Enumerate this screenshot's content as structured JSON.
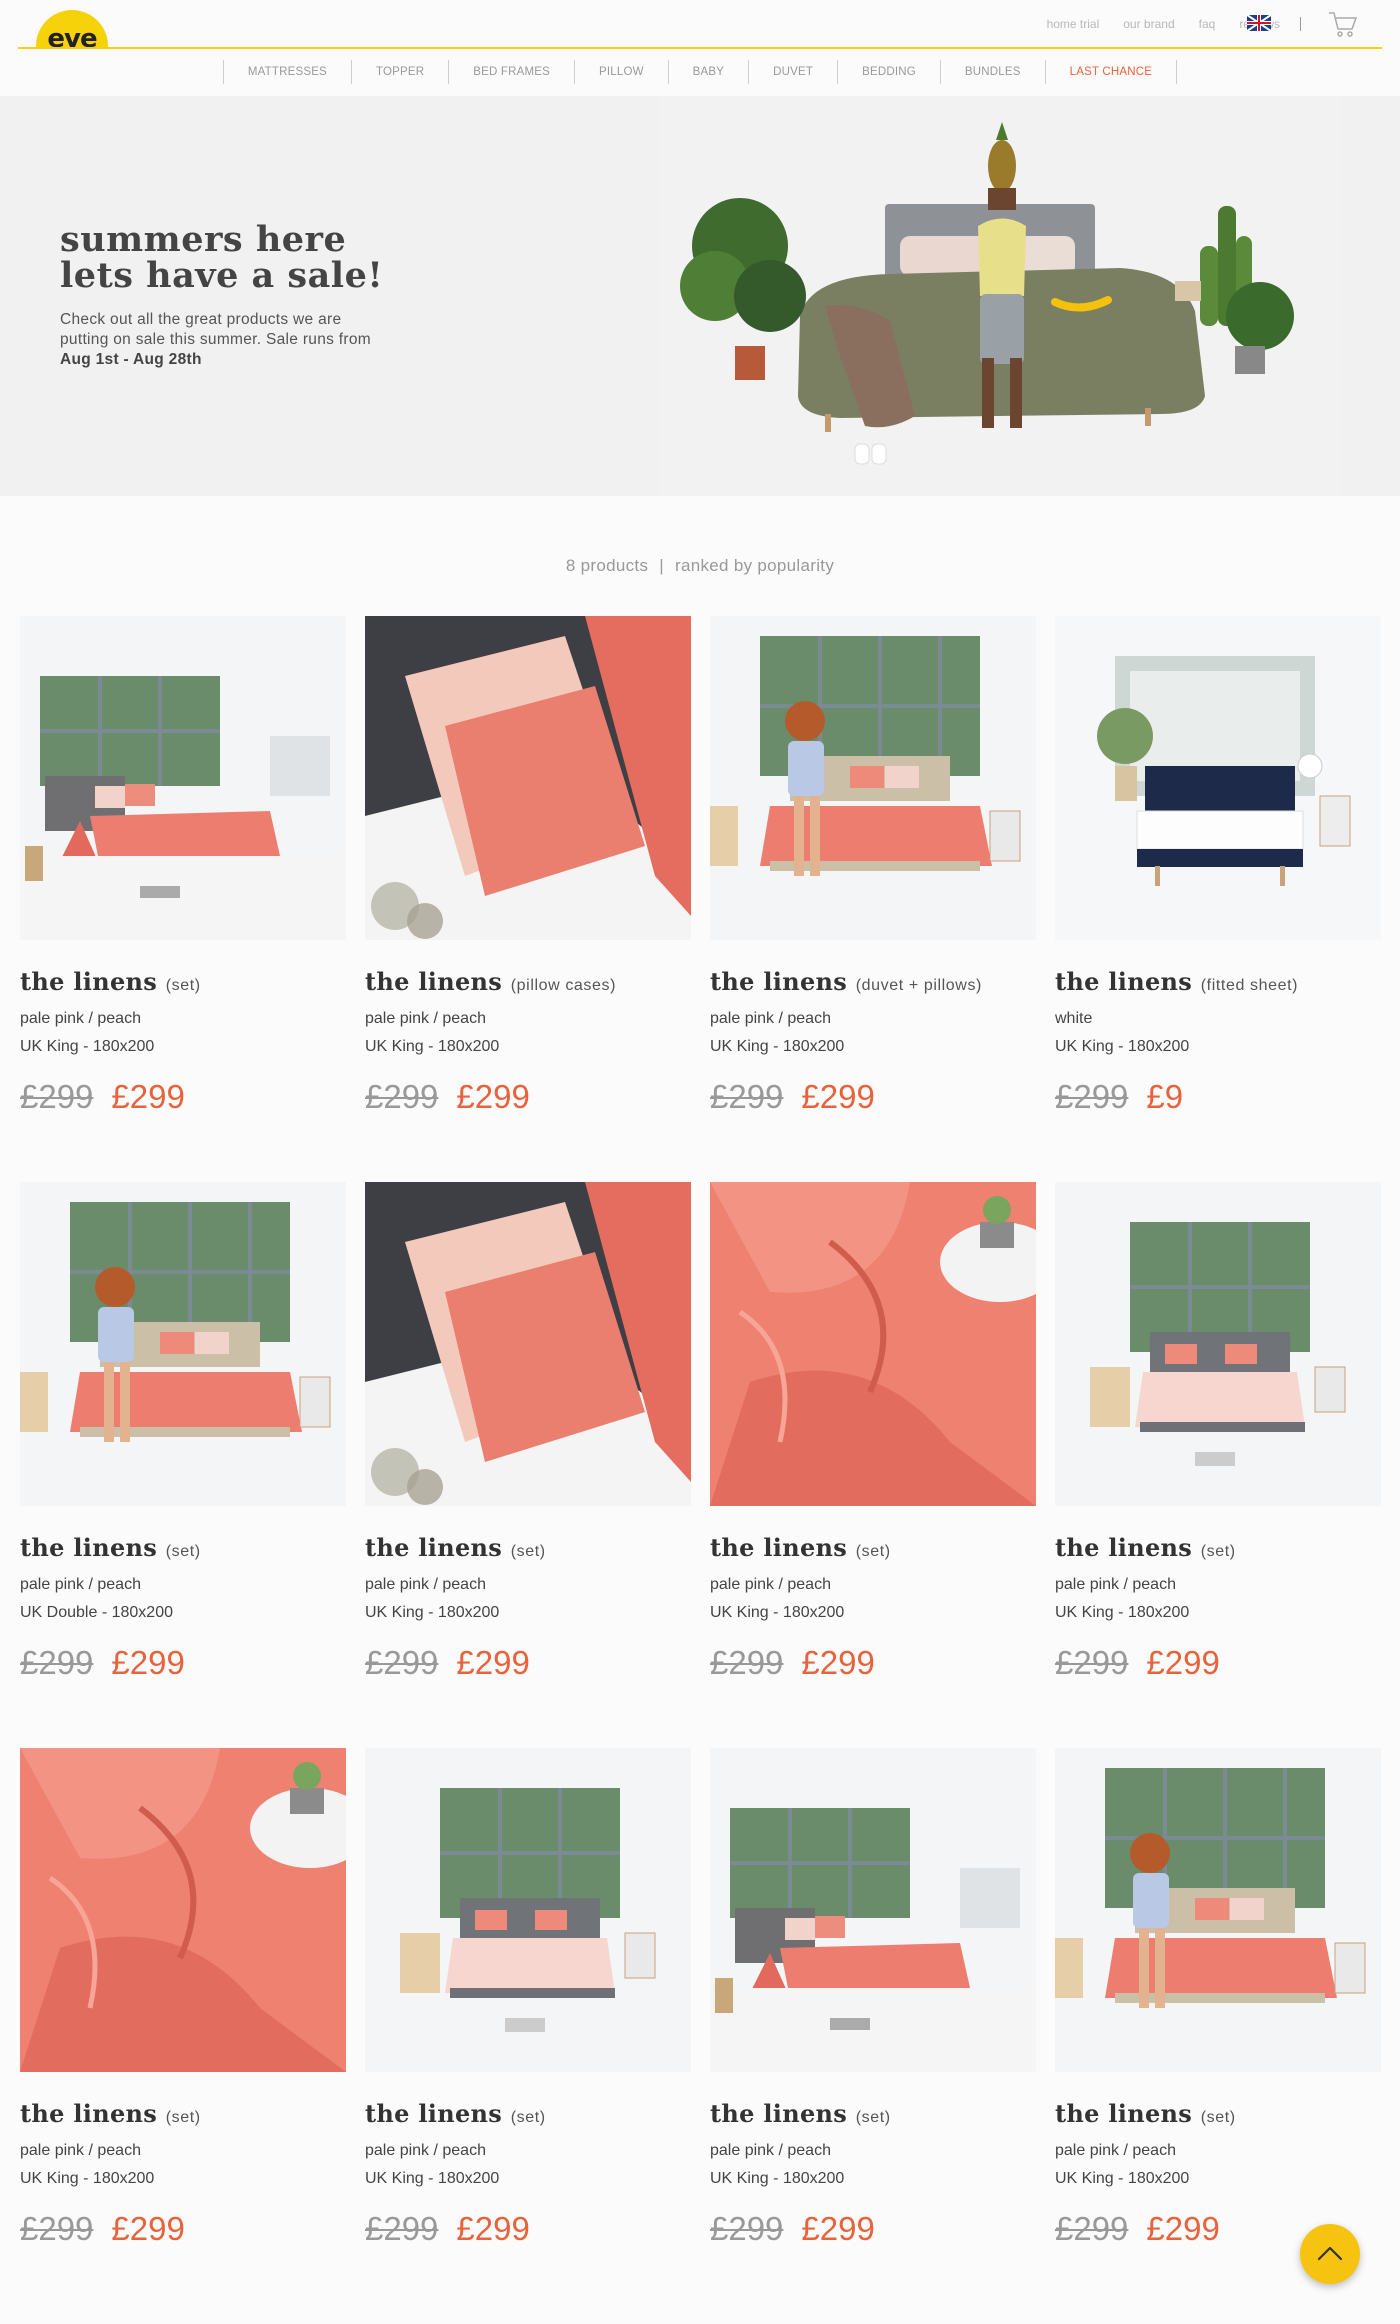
{
  "brand": {
    "logo_text": "eve"
  },
  "top_links": [
    "home trial",
    "our brand",
    "faq",
    "reviews"
  ],
  "nav": [
    "MATTRESSES",
    "TOPPER",
    "BED FRAMES",
    "PILLOW",
    "BABY",
    "DUVET",
    "BEDDING",
    "BUNDLES",
    "LAST CHANCE"
  ],
  "hero": {
    "title_line1": "summers here",
    "title_line2": "lets have a sale!",
    "desc_prefix": "Check out all the great products we are putting on sale this summer. Sale runs from ",
    "desc_dates": "Aug 1st - Aug 28th"
  },
  "listing": {
    "count_text": "8 products",
    "divider": "|",
    "sort_text": "ranked by popularity"
  },
  "colors": {
    "accent": "#e8623c",
    "brand_yellow": "#f6d20a",
    "muted": "#999999"
  },
  "products": [
    {
      "title": "the linens",
      "variant": "(set)",
      "color": "pale pink / peach",
      "size": "UK King - 180x200",
      "old_price": "£299",
      "price": "£299",
      "image": "bedroom-bed-angle"
    },
    {
      "title": "the linens",
      "variant": "(pillow cases)",
      "color": "pale pink / peach",
      "size": "UK King - 180x200",
      "old_price": "£299",
      "price": "£299",
      "image": "pillow-closeup"
    },
    {
      "title": "the linens",
      "variant": "(duvet + pillows)",
      "color": "pale pink / peach",
      "size": "UK King - 180x200",
      "old_price": "£299",
      "price": "£299",
      "image": "woman-on-bed"
    },
    {
      "title": "the linens",
      "variant": "(fitted sheet)",
      "color": "white",
      "size": "UK King - 180x200",
      "old_price": "£299",
      "price": "£9",
      "image": "navy-bed-white-room"
    },
    {
      "title": "the linens",
      "variant": "(set)",
      "color": "pale pink / peach",
      "size": "UK Double - 180x200",
      "old_price": "£299",
      "price": "£299",
      "image": "woman-on-bed"
    },
    {
      "title": "the linens",
      "variant": "(set)",
      "color": "pale pink / peach",
      "size": "UK King - 180x200",
      "old_price": "£299",
      "price": "£299",
      "image": "pillow-closeup"
    },
    {
      "title": "the linens",
      "variant": "(set)",
      "color": "pale pink / peach",
      "size": "UK King - 180x200",
      "old_price": "£299",
      "price": "£299",
      "image": "duvet-closeup"
    },
    {
      "title": "the linens",
      "variant": "(set)",
      "color": "pale pink / peach",
      "size": "UK King - 180x200",
      "old_price": "£299",
      "price": "£299",
      "image": "bedroom-bed-front"
    },
    {
      "title": "the linens",
      "variant": "(set)",
      "color": "pale pink / peach",
      "size": "UK King - 180x200",
      "old_price": "£299",
      "price": "£299",
      "image": "duvet-closeup"
    },
    {
      "title": "the linens",
      "variant": "(set)",
      "color": "pale pink / peach",
      "size": "UK King - 180x200",
      "old_price": "£299",
      "price": "£299",
      "image": "bedroom-bed-front"
    },
    {
      "title": "the linens",
      "variant": "(set)",
      "color": "pale pink / peach",
      "size": "UK King - 180x200",
      "old_price": "£299",
      "price": "£299",
      "image": "bedroom-bed-angle"
    },
    {
      "title": "the linens",
      "variant": "(set)",
      "color": "pale pink / peach",
      "size": "UK King - 180x200",
      "old_price": "£299",
      "price": "£299",
      "image": "woman-on-bed"
    }
  ]
}
